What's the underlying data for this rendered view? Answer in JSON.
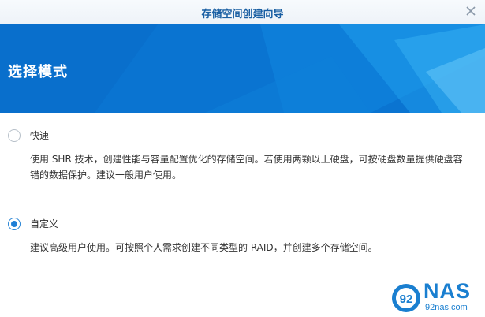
{
  "window": {
    "title": "存储空间创建向导",
    "close_icon": "close-icon"
  },
  "header": {
    "title": "选择模式"
  },
  "options": [
    {
      "label": "快速",
      "selected": false,
      "description": "使用 SHR 技术，创建性能与容量配置优化的存储空间。若使用两颗以上硬盘，可按硬盘数量提供硬盘容错的数据保护。建议一般用户使用。"
    },
    {
      "label": "自定义",
      "selected": true,
      "description": "建议高级用户使用。可按照个人需求创建不同类型的 RAID，并创建多个存储空间。"
    }
  ],
  "watermark": {
    "brand": "NAS",
    "site": "92nas.com",
    "icon": "92-logo-icon"
  },
  "colors": {
    "header_blue": "#0b78d4",
    "title_blue": "#1a5fa3",
    "radio_blue": "#1f7fd6",
    "logo_blue": "#1a7fd0"
  }
}
